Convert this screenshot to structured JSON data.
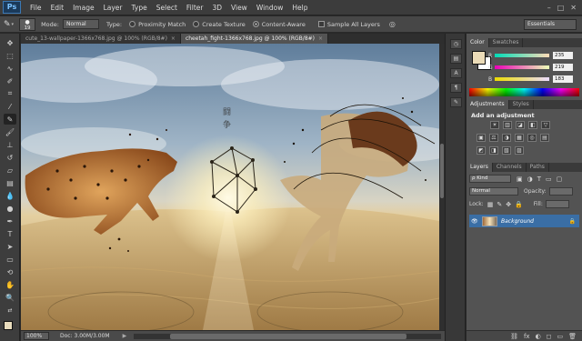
{
  "app": {
    "logo": "Ps"
  },
  "menu": [
    "File",
    "Edit",
    "Image",
    "Layer",
    "Type",
    "Select",
    "Filter",
    "3D",
    "View",
    "Window",
    "Help"
  ],
  "window_controls": [
    "–",
    "□",
    "✕"
  ],
  "options_bar": {
    "brush_size": "19",
    "mode_label": "Mode:",
    "mode_value": "Normal",
    "type_label": "Type:",
    "type_options": [
      "Proximity Match",
      "Create Texture",
      "Content-Aware"
    ],
    "type_selected": "Content-Aware",
    "sample_all_layers": "Sample All Layers",
    "workspace": "Essentials"
  },
  "documents": {
    "tabs": [
      {
        "title": "cute_13-wallpaper-1366x768.jpg @ 100% (RGB/8#)",
        "active": false
      },
      {
        "title": "cheetah_fight-1366x768.jpg @ 100% (RGB/8#)",
        "active": true
      }
    ],
    "close_glyph": "×"
  },
  "status": {
    "zoom": "100%",
    "doc_size": "Doc: 3.00M/3.00M",
    "arrow": "▶"
  },
  "color_panel": {
    "tabs": [
      "Color",
      "Swatches"
    ],
    "channels": [
      {
        "label": "R",
        "value": "235"
      },
      {
        "label": "G",
        "value": "219"
      },
      {
        "label": "B",
        "value": "183"
      }
    ],
    "foreground": "#ebdbb7",
    "background": "#ffffff"
  },
  "adjustments_panel": {
    "tabs": [
      "Adjustments",
      "Styles"
    ],
    "title": "Add an adjustment",
    "rows": [
      [
        "☀",
        "▥",
        "◪",
        "◧",
        "▽"
      ],
      [
        "▣",
        "⚖",
        "◑",
        "▦",
        "◎",
        "▤"
      ],
      [
        "◩",
        "◨",
        "▧",
        "▨"
      ]
    ]
  },
  "layers_panel": {
    "tabs": [
      "Layers",
      "Channels",
      "Paths"
    ],
    "filter_kind": "ρ Kind",
    "blend_mode": "Normal",
    "opacity_label": "Opacity:",
    "opacity_value": "",
    "lock_label": "Lock:",
    "fill_label": "Fill:",
    "fill_value": "",
    "layer_name": "Background",
    "footer_icons": [
      "⛓",
      "fx",
      "◐",
      "◻",
      "▭",
      "🗑"
    ]
  }
}
